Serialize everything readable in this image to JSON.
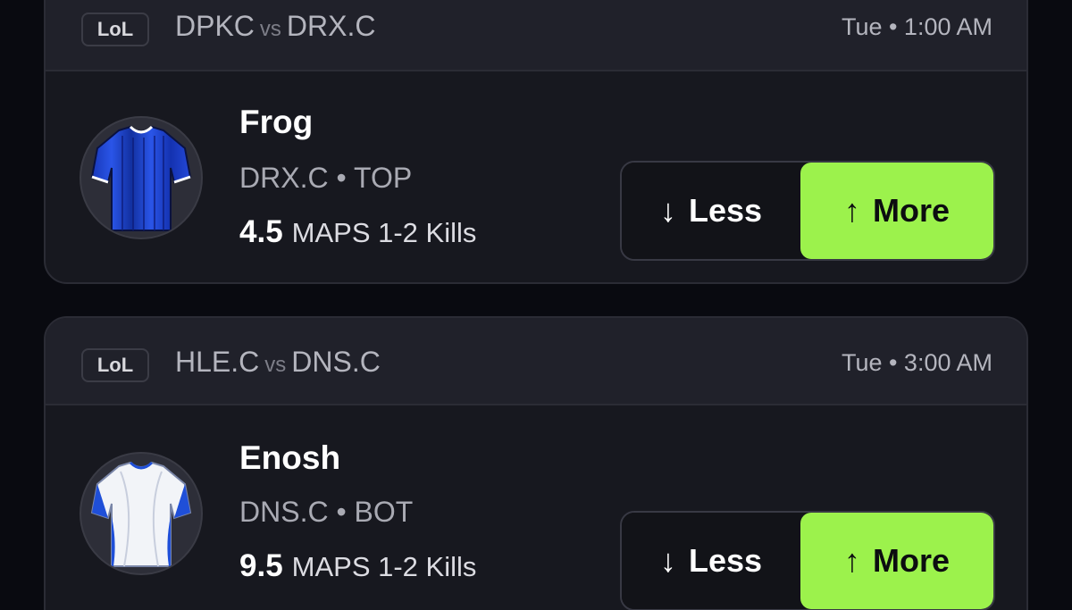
{
  "cards": [
    {
      "league": "LoL",
      "team_a": "DPKC",
      "vs": "vs",
      "team_b": "DRX.C",
      "time": "Tue • 1:00 AM",
      "player": {
        "name": "Frog",
        "team_position": "DRX.C • TOP",
        "line": "4.5",
        "stat": "MAPS 1-2 Kills",
        "jersey": "blue-jersey"
      },
      "less_label": "Less",
      "more_label": "More"
    },
    {
      "league": "LoL",
      "team_a": "HLE.C",
      "vs": "vs",
      "team_b": "DNS.C",
      "time": "Tue • 3:00 AM",
      "player": {
        "name": "Enosh",
        "team_position": "DNS.C • BOT",
        "line": "9.5",
        "stat": "MAPS 1-2 Kills",
        "jersey": "white-blue-jersey"
      },
      "less_label": "Less",
      "more_label": "More"
    }
  ],
  "icons": {
    "less": "arrow-down-icon",
    "more": "arrow-up-icon"
  },
  "colors": {
    "background": "#090a10",
    "card": "#17181f",
    "more_accent": "#9cf24c"
  }
}
